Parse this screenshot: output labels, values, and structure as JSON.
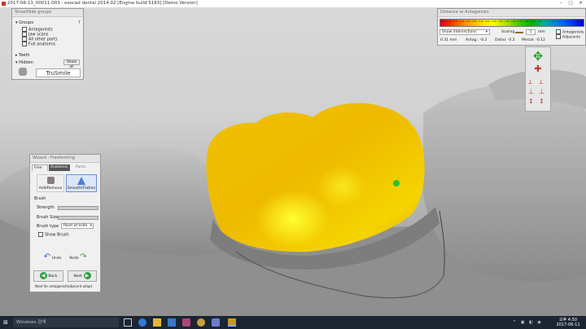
{
  "window": {
    "title": "2017-06-11_00011-003 - exocad dental 2014.02 [Engine build 5183] [Demo Version]"
  },
  "groups_panel": {
    "header": "Show/Hide groups",
    "groups_label": "Groups",
    "help_label": "?",
    "items": [
      "Antagonists",
      "Jaw scans",
      "All other parts",
      "Full anatomic"
    ],
    "teeth_label": "Teeth",
    "hidden_label": "Hidden",
    "show_all_label": "Show all",
    "brand": "TruSmile"
  },
  "distance_panel": {
    "header": "Distance to Antagonists",
    "scale_ticks": [
      "-0.41",
      "-0.31",
      "-0.21",
      "-0.11",
      "-0.01",
      "0.09",
      "0.19",
      "0.29",
      "0.39",
      "0.49",
      "0.59",
      "0.69",
      "0.79",
      "0.89",
      "0.99",
      "1.09",
      "1.19",
      "1.29",
      "1.39",
      "1.49",
      "1.59",
      "1.69"
    ],
    "gradient_colors": [
      "#d0021b",
      "#ff4000",
      "#ff9800",
      "#ffd400",
      "#ffff00",
      "#b8e000",
      "#4cc800",
      "#00b400",
      "#00b0a0",
      "#0080e0",
      "#0040ff",
      "#0000d0"
    ],
    "dropdown_value": "Show intersections",
    "scaling_label": "Scaling",
    "scaling_value": "1",
    "scaling_unit": "mm",
    "value_1": "0.31 mm",
    "antag_label": "Antag.: -0.2",
    "distal_label": "Distal: -0.2",
    "mesial_label": "Mesial: -0.12",
    "check_antagonists": "Antagonists",
    "check_adjacents": "Adjacents"
  },
  "wizard_panel": {
    "header": "Wizard - Freeforming",
    "tabs": [
      "Free",
      "Anatomic",
      "Partic"
    ],
    "tool_add_remove": "Add/Remove",
    "tool_smooth": "Smooth/Flatten",
    "brush_section": "Brush",
    "strength_label": "Strength",
    "brush_size_label": "Brush Size",
    "brush_type_label": "Brush type",
    "brush_type_value": "Point of knife",
    "show_brush_label": "Show Brush",
    "undo_label": "Undo",
    "redo_label": "Redo",
    "back_label": "Back",
    "next_label": "Next",
    "hint": "Next for antagonist/adjacent adapt"
  },
  "taskbar": {
    "search_placeholder": "Windows 검색",
    "time": "오후 4:50",
    "date": "2017-06-11"
  }
}
